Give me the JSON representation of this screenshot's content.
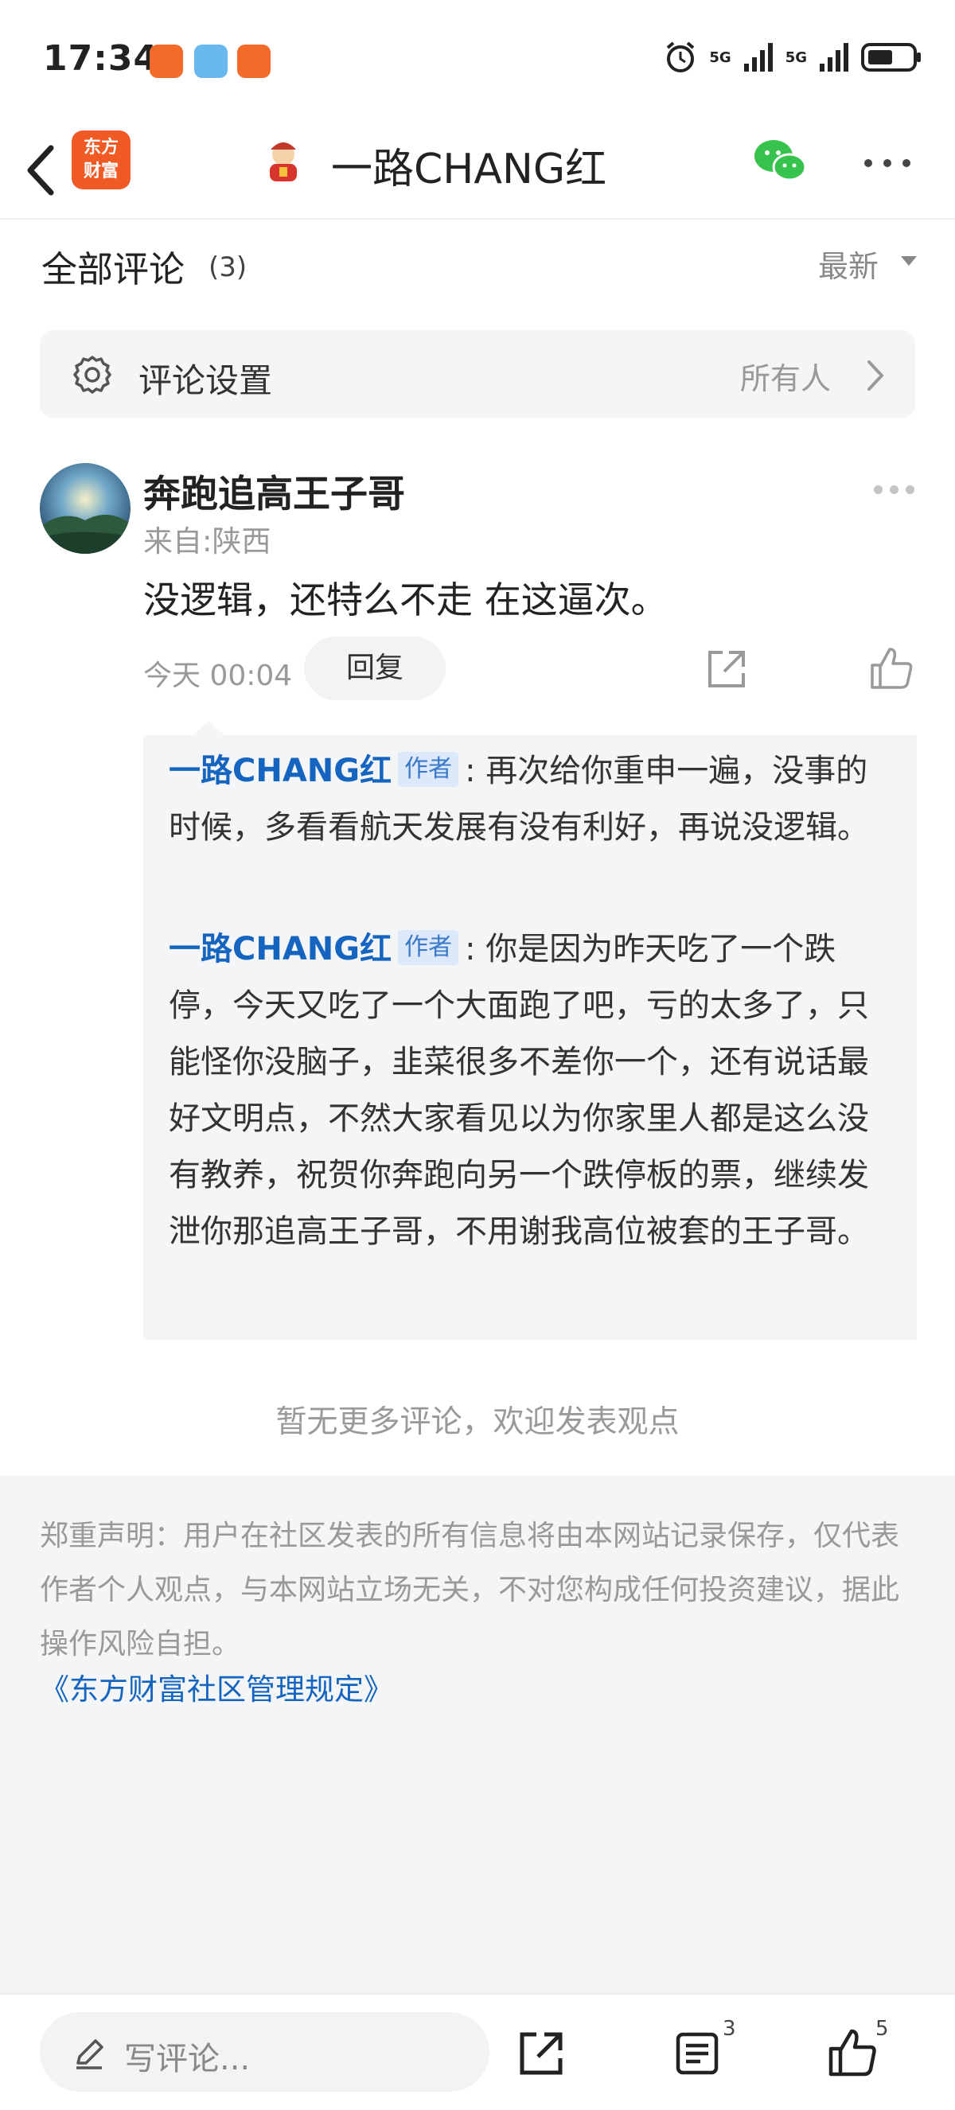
{
  "status_bar": {
    "time": "17:34",
    "signal_1": "5G",
    "signal_2": "5G"
  },
  "nav": {
    "logo_text_line1": "东方",
    "logo_text_line2": "财富",
    "title": "一路CHANG红"
  },
  "comments_header": {
    "title": "全部评论",
    "count": "(3)",
    "sort_label": "最新"
  },
  "settings": {
    "label": "评论设置",
    "value": "所有人"
  },
  "comment": {
    "user_name": "奔跑追高王子哥",
    "location": "来自:陕西",
    "text": "没逻辑，还特么不走 在这逼次。",
    "time": "今天 00:04",
    "reply_label": "回复"
  },
  "replies": [
    {
      "author": "一路CHANG红",
      "badge": "作者",
      "text": ": 再次给你重申一遍，没事的时候，多看看航天发展有没有利好，再说没逻辑。"
    },
    {
      "author": "一路CHANG红",
      "badge": "作者",
      "text": ": 你是因为昨天吃了一个跌停，今天又吃了一个大面跑了吧，亏的太多了，只能怪你没脑子，韭菜很多不差你一个，还有说话最好文明点，不然大家看见以为你家里人都是这么没有教养，祝贺你奔跑向另一个跌停板的票，继续发泄你那追高王子哥，不用谢我高位被套的王子哥。"
    }
  ],
  "no_more": "暂无更多评论，欢迎发表观点",
  "disclaimer": {
    "text": "郑重声明：用户在社区发表的所有信息将由本网站记录保存，仅代表作者个人观点，与本网站立场无关，不对您构成任何投资建议，据此操作风险自担。",
    "link": "《东方财富社区管理规定》"
  },
  "bottom_bar": {
    "placeholder": "写评论...",
    "list_count": "3",
    "like_count": "5"
  },
  "colors": {
    "accent_blue": "#1565c0",
    "brand_orange": "#f05a24",
    "wechat_green": "#36c24c"
  }
}
